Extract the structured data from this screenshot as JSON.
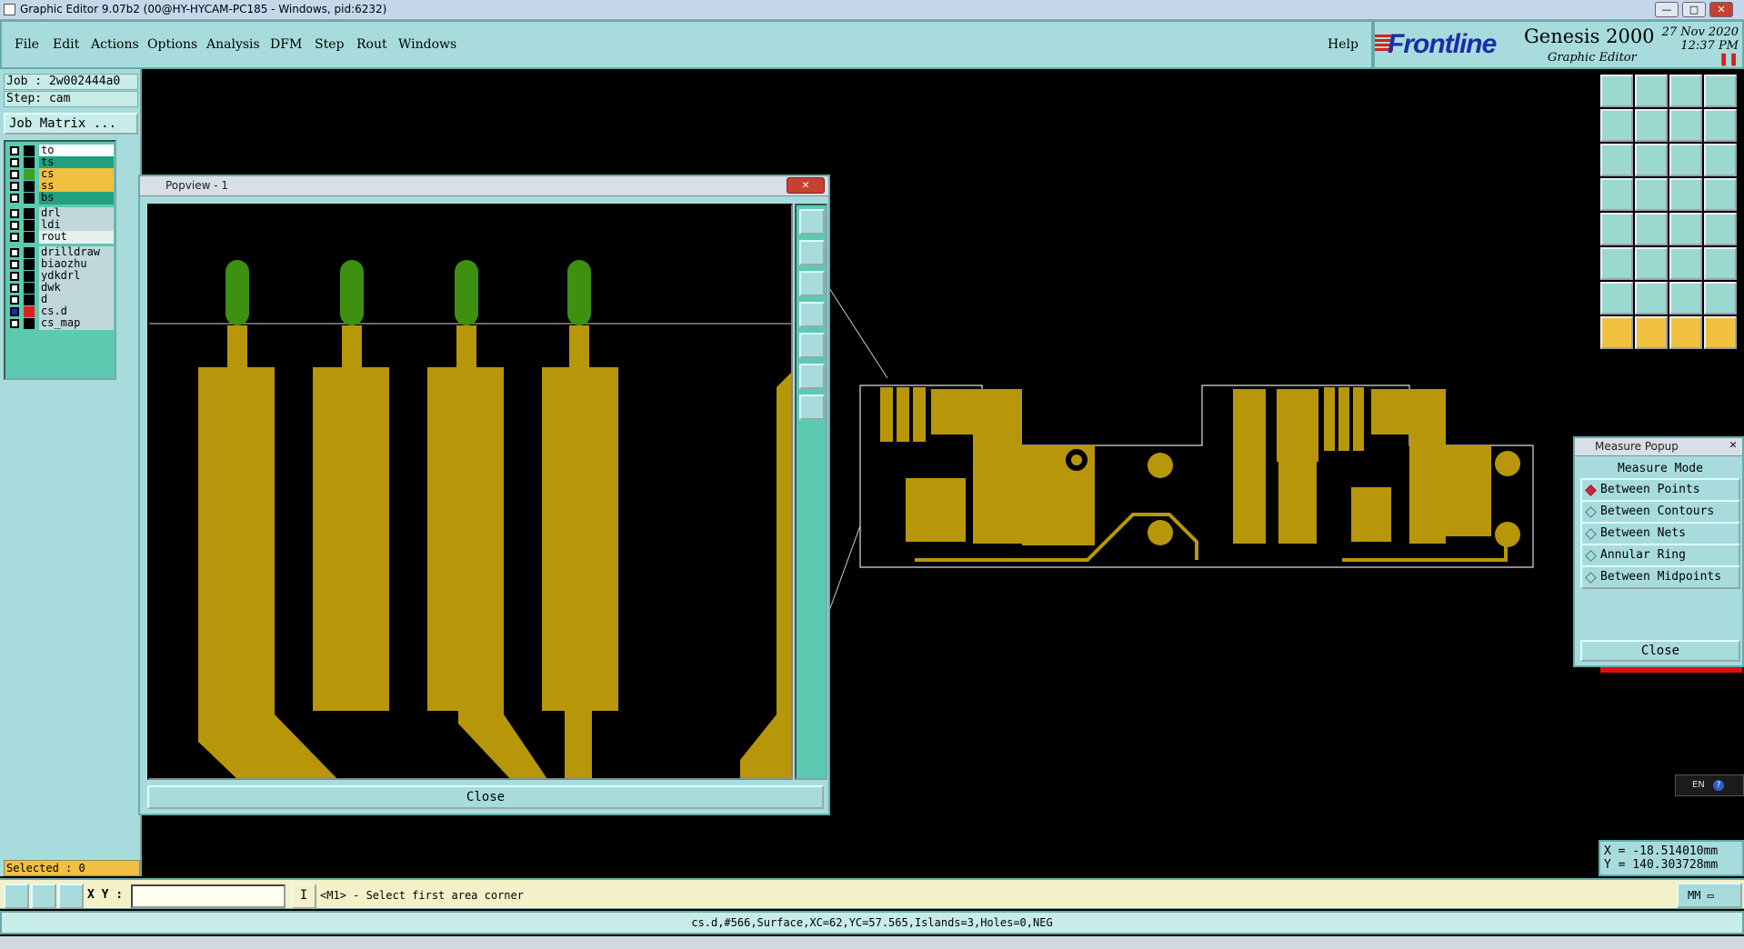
{
  "window": {
    "title": "Graphic Editor 9.07b2 (00@HY-HYCAM-PC185 - Windows, pid:6232)",
    "min_label": "—",
    "max_label": "□",
    "close_label": "✕"
  },
  "menu": {
    "items": [
      "File",
      "Edit",
      "Actions",
      "Options",
      "Analysis",
      "DFM",
      "Step",
      "Rout",
      "Windows"
    ],
    "help": "Help"
  },
  "brand": {
    "logo": "Frontline",
    "product": "Genesis 2000",
    "subtitle": "Graphic Editor",
    "date": "27 Nov 2020",
    "time": "12:37 PM",
    "logo_color": "#1a2ea8",
    "accent_color": "#d82020"
  },
  "job": {
    "job_line": "Job : 2w002444a0",
    "step_line": "Step: cam",
    "job_matrix_label": "Job Matrix ..."
  },
  "layers": [
    {
      "name": "to",
      "color": "#ffffff",
      "swatch": "#000000",
      "checked": false
    },
    {
      "name": "ts",
      "color": "#20a080",
      "swatch": "#000000",
      "checked": false
    },
    {
      "name": "cs",
      "color": "#f0c040",
      "swatch": "#40a020",
      "checked": false
    },
    {
      "name": "ss",
      "color": "#f0c040",
      "swatch": "#000000",
      "checked": false
    },
    {
      "name": "bs",
      "color": "#20a080",
      "swatch": "#000000",
      "checked": false
    },
    {
      "name": "drl",
      "color": "#c0d8dc",
      "swatch": "#000000",
      "checked": false
    },
    {
      "name": "ldi",
      "color": "#c0d8dc",
      "swatch": "#000000",
      "checked": false
    },
    {
      "name": "rout",
      "color": "#e8f0f0",
      "swatch": "#000000",
      "checked": false
    },
    {
      "name": "drilldraw",
      "color": "#c0d8dc",
      "swatch": "#000000",
      "checked": false
    },
    {
      "name": "biaozhu",
      "color": "#c0d8dc",
      "swatch": "#000000",
      "checked": false
    },
    {
      "name": "ydkdrl",
      "color": "#c0d8dc",
      "swatch": "#000000",
      "checked": false
    },
    {
      "name": "dwk",
      "color": "#c0d8dc",
      "swatch": "#000000",
      "checked": false
    },
    {
      "name": "d",
      "color": "#c0d8dc",
      "swatch": "#000000",
      "checked": false
    },
    {
      "name": "cs.d",
      "color": "#c0d8dc",
      "swatch": "#e02020",
      "checked": true
    },
    {
      "name": "cs_map",
      "color": "#c0d8dc",
      "swatch": "#000000",
      "checked": false
    }
  ],
  "selected_label": "Selected : 0",
  "popview": {
    "title": "Popview - 1",
    "close_label": "Close"
  },
  "measure": {
    "title": "Measure Popup",
    "mode_label": "Measure Mode",
    "options": [
      {
        "label": "Between Points",
        "selected": true
      },
      {
        "label": "Between Contours",
        "selected": false
      },
      {
        "label": "Between Nets",
        "selected": false
      },
      {
        "label": "Annular Ring",
        "selected": false
      },
      {
        "label": "Between Midpoints",
        "selected": false
      }
    ],
    "close_label": "Close"
  },
  "coords": {
    "x": "X = -18.514010mm",
    "y": "Y = 140.303728mm"
  },
  "command": {
    "xy_label": "X Y :",
    "xy_value": "",
    "prompt": "<M1> - Select first area corner",
    "units": "MM"
  },
  "status": "cs.d,#566,Surface,XC=62,YC=57.565,Islands=3,Holes=0,NEG",
  "lang_indicator": "EN",
  "colors": {
    "panel": "#a8dcdc",
    "copper": "#b8960a",
    "canvas": "#000000"
  }
}
